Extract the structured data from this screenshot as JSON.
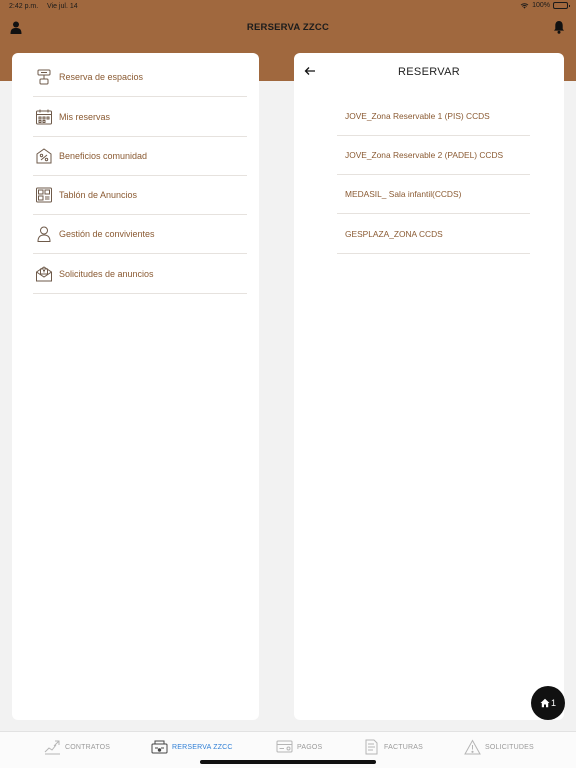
{
  "status_bar": {
    "time": "2:42 p.m.",
    "date": "Vie jul. 14",
    "battery": "100%"
  },
  "header": {
    "title": "RERSERVA ZZCC",
    "left_icon": "user-icon",
    "right_icon": "bell-icon"
  },
  "left_menu": {
    "items": [
      {
        "label": "Reserva de espacios",
        "icon": "space-reservation-icon"
      },
      {
        "label": "Mis reservas",
        "icon": "calendar-icon"
      },
      {
        "label": "Beneficios comunidad",
        "icon": "discount-tag-icon"
      },
      {
        "label": "Tablón de Anuncios",
        "icon": "bulletin-board-icon"
      },
      {
        "label": "Gestión de convivientes",
        "icon": "person-icon"
      },
      {
        "label": "Solicitudes de anuncios",
        "icon": "mail-request-icon"
      }
    ]
  },
  "right_panel": {
    "title": "RESERVAR",
    "items": [
      {
        "label": "JOVE_Zona Reservable 1 (PIS) CCDS"
      },
      {
        "label": "JOVE_Zona Reservable 2 (PADEL) CCDS"
      },
      {
        "label": "MEDASIL_ Sala infantil(CCDS)"
      },
      {
        "label": "GESPLAZA_ZONA CCDS"
      }
    ]
  },
  "fab": {
    "count": "1",
    "icon": "home-icon"
  },
  "tabbar": {
    "active_color": "#2f7fd6",
    "inactive_color": "#9a9a9a",
    "tabs": [
      {
        "label": "CONTRATOS",
        "icon": "contracts-icon",
        "active": false
      },
      {
        "label": "RERSERVA ZZCC",
        "icon": "reservation-icon",
        "active": true
      },
      {
        "label": "PAGOS",
        "icon": "payments-icon",
        "active": false
      },
      {
        "label": "FACTURAS",
        "icon": "invoices-icon",
        "active": false
      },
      {
        "label": "SOLICITUDES",
        "icon": "warning-icon",
        "active": false
      }
    ]
  },
  "colors": {
    "header": "#a0683e",
    "accent_text": "#8a5a32",
    "background": "#f2f2f2"
  }
}
